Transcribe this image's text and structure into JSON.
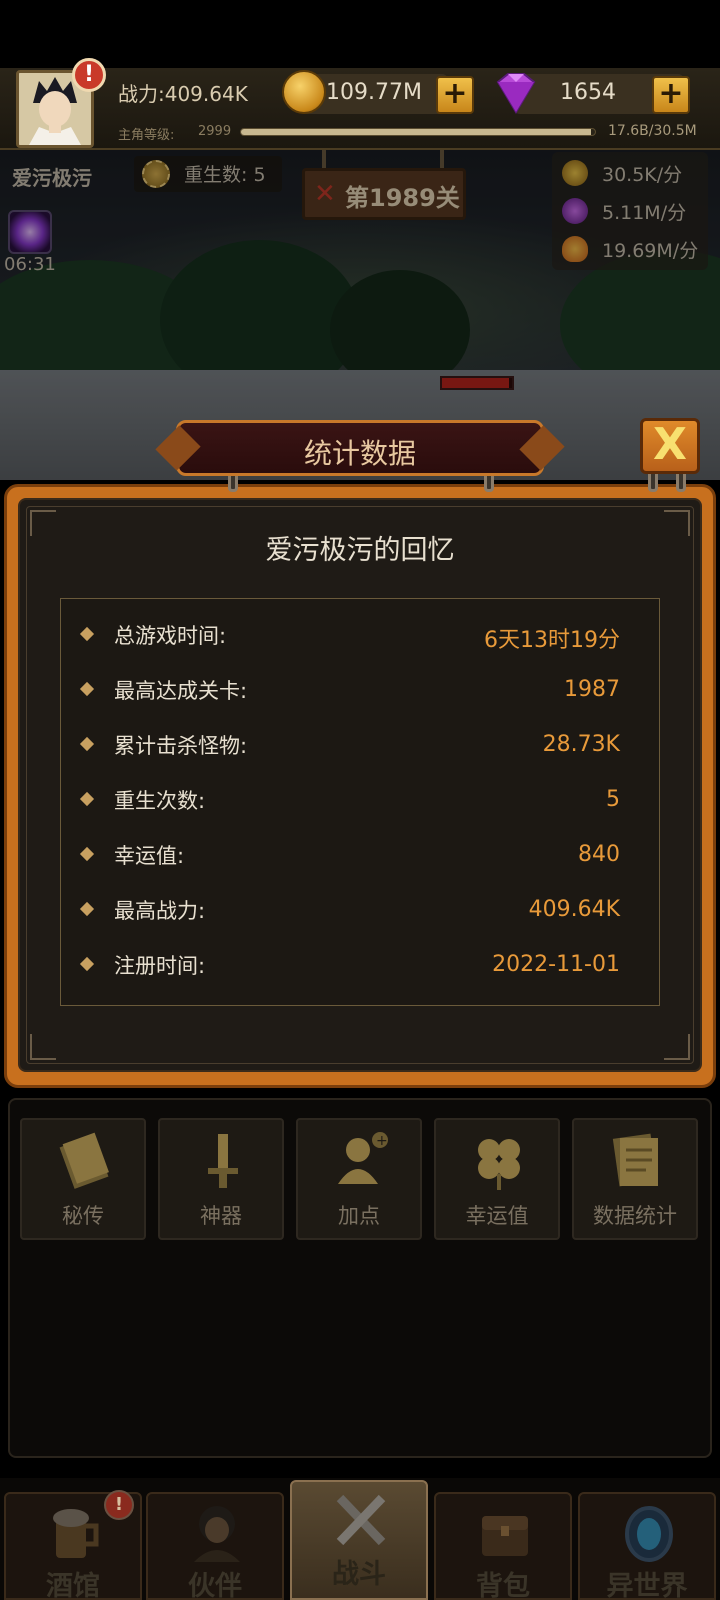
{
  "hud": {
    "power": "战力:409.64K",
    "gold": "109.77M",
    "gems": "1654",
    "level_label": "主角等级:",
    "level_value": "2999",
    "exp_text": "17.6B/30.5M",
    "exp_fraction": 0.99,
    "alert": "!"
  },
  "scene": {
    "player_name": "爱污极污",
    "rebirth": "重生数: 5",
    "stage": "第1989关",
    "rates": [
      "30.5K/分",
      "5.11M/分",
      "19.69M/分"
    ],
    "skill_timer": "06:31",
    "enemy_hp_fraction": 0.95
  },
  "dialog": {
    "title": "统计数据",
    "close": "X",
    "memory_title": "爱污极污的回忆",
    "stats": [
      {
        "label": "总游戏时间:",
        "value": "6天13时19分"
      },
      {
        "label": "最高达成关卡:",
        "value": "1987"
      },
      {
        "label": "累计击杀怪物:",
        "value": "28.73K"
      },
      {
        "label": "重生次数:",
        "value": "5"
      },
      {
        "label": "幸运值:",
        "value": "840"
      },
      {
        "label": "最高战力:",
        "value": "409.64K"
      },
      {
        "label": "注册时间:",
        "value": "2022-11-01"
      }
    ]
  },
  "functions": [
    {
      "label": "秘传",
      "icon": "book-icon"
    },
    {
      "label": "神器",
      "icon": "sword-icon"
    },
    {
      "label": "加点",
      "icon": "add-point-icon"
    },
    {
      "label": "幸运值",
      "icon": "clover-icon"
    },
    {
      "label": "数据统计",
      "icon": "document-icon"
    }
  ],
  "nav": [
    {
      "label": "酒馆",
      "icon": "beer-icon",
      "badge": "!"
    },
    {
      "label": "伙伴",
      "icon": "partner-icon"
    },
    {
      "label": "战斗",
      "icon": "crossed-swords-icon",
      "active": true
    },
    {
      "label": "背包",
      "icon": "chest-icon"
    },
    {
      "label": "异世界",
      "icon": "portal-icon"
    }
  ],
  "colors": {
    "accent_orange": "#e89a3a",
    "frame_orange": "#c8701e",
    "dialog_bg": "#1f1b16"
  }
}
